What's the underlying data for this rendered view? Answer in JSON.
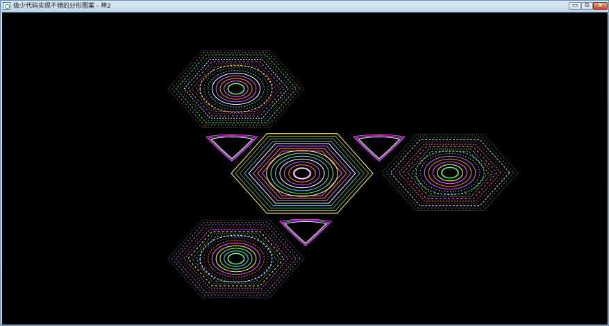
{
  "window": {
    "title": "极少代码实现不错的分形图案 - 神2",
    "controls": {
      "minimize_glyph": "▭",
      "maximize_glyph": "⧉",
      "close_glyph": "✕"
    }
  },
  "icons": {
    "app": "app-icon",
    "minimize": "minimize-icon",
    "maximize": "restore-icon",
    "close": "close-icon"
  },
  "colors": {
    "background": "#000000",
    "palette": [
      "#ff55ff",
      "#ffff66",
      "#66ff66",
      "#66ccff",
      "#ffffff",
      "#cc66ff",
      "#ff8844"
    ]
  }
}
